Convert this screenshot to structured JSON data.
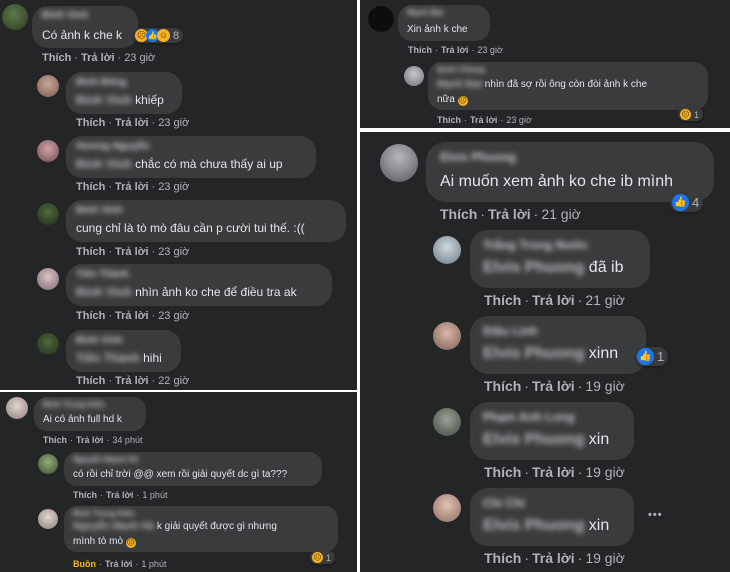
{
  "labels": {
    "like": "Thích",
    "reply": "Trả lời",
    "sad": "Buồn",
    "sep": "·"
  },
  "panel1": {
    "main": {
      "author": "Đinh Vinh",
      "text": "Có ảnh k che k",
      "time": "23 giờ",
      "reaction_count": "8"
    },
    "replies": [
      {
        "author": "Đình Bông",
        "mention": "Đinh Vinh",
        "text": "khiếp",
        "time": "23 giờ"
      },
      {
        "author": "Hương Nguyễn",
        "mention": "Đinh Vinh",
        "text": "chắc có mà chưa thấy ai up",
        "time": "23 giờ"
      },
      {
        "author": "Đinh Vinh",
        "mention": "",
        "text": "cung chỉ là tò mò đâu cần p cười tui thế. :((",
        "time": "23 giờ"
      },
      {
        "author": "Tiến Thành",
        "mention": "Đinh Vinh",
        "text": "nhìn ảnh ko che để điều tra ak",
        "time": "23 giờ"
      },
      {
        "author": "Đinh Vinh",
        "mention": "Tiến Thành",
        "text": "hihi",
        "time": "22 giờ"
      }
    ]
  },
  "panel2": {
    "main": {
      "author": "Đinh Trung Kiên",
      "text": "Ai có ảnh full hd k",
      "time": "34 phút"
    },
    "replies": [
      {
        "author": "Nguyễn Mạnh Hà",
        "text": "có rồi chỉ trời @@ xem rồi giải quyết dc gì ta???",
        "time": "1 phút"
      },
      {
        "author": "Đinh Trung Kiên",
        "mention": "Nguyễn Mạnh Hà",
        "text_line1": "k giải quyết được gì nhưng",
        "text_line2": "mình tò mò",
        "time": "1 phút",
        "reaction_count": "1"
      }
    ]
  },
  "panel3": {
    "main": {
      "author": "Mạnh Đạt",
      "text": "Xin ảnh k che",
      "time": "23 giờ"
    },
    "reply": {
      "author": "Quốc Chung",
      "mention": "Mạnh Đạt",
      "text_line1": "nhìn đã sợ rồi ông còn đòi ảnh k che",
      "text_line2": "nữa",
      "time": "23 giờ",
      "reaction_count": "1"
    }
  },
  "panel4": {
    "main": {
      "author": "Elvis Phuong",
      "text": "Ai muốn xem ảnh ko che ib mình",
      "time": "21 giờ",
      "reaction_count": "4"
    },
    "replies": [
      {
        "author": "Trắng Trong Nước",
        "mention": "Elvis Phuong",
        "text": "đã ib",
        "time": "21 giờ"
      },
      {
        "author": "Diệu Linh",
        "mention": "Elvis Phuong",
        "text": "xinn",
        "time": "19 giờ",
        "reaction_count": "1"
      },
      {
        "author": "Phạm Anh Long",
        "mention": "Elvis Phuong",
        "text": "xin",
        "time": "19 giờ"
      },
      {
        "author": "Chi Chi",
        "mention": "Elvis Phuong",
        "text": "xin",
        "time": "19 giờ"
      }
    ],
    "more": "•••"
  }
}
